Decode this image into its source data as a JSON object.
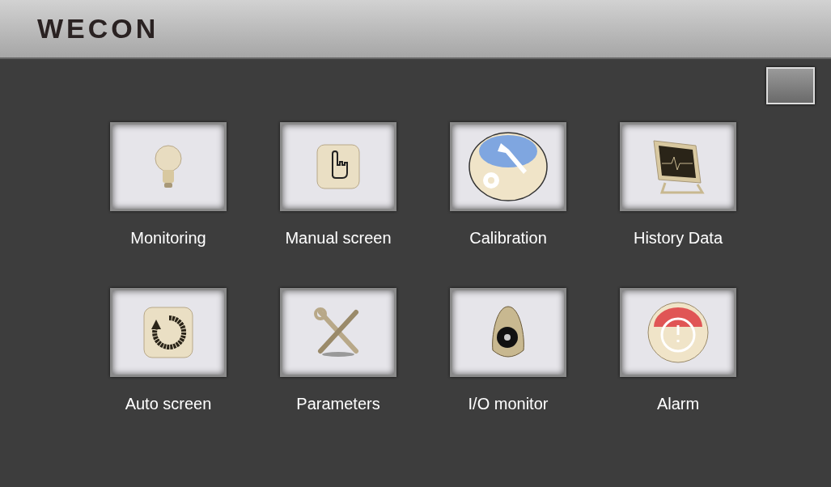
{
  "header": {
    "logo": "WECON"
  },
  "tiles": [
    {
      "label": "Monitoring",
      "kind": "bulb"
    },
    {
      "label": "Manual screen",
      "kind": "hand"
    },
    {
      "label": "Calibration",
      "kind": "calibration"
    },
    {
      "label": "History Data",
      "kind": "monitor"
    },
    {
      "label": "Auto screen",
      "kind": "rotate"
    },
    {
      "label": "Parameters",
      "kind": "tools"
    },
    {
      "label": "I/O monitor",
      "kind": "knob"
    },
    {
      "label": "Alarm",
      "kind": "alarm"
    }
  ]
}
